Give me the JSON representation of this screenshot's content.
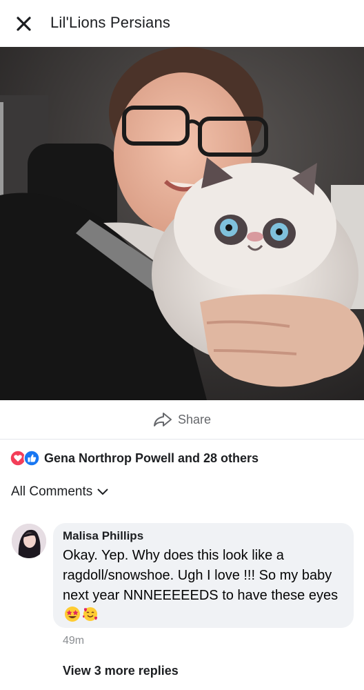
{
  "header": {
    "title": "Lil'Lions Persians",
    "close_icon": "close-icon"
  },
  "post": {
    "photo_description_icon": "post-photo",
    "share_label": "Share",
    "share_icon": "share-arrow-icon"
  },
  "reactions": {
    "icons": [
      "love-reaction-icon",
      "like-reaction-icon"
    ],
    "summary": "Gena Northrop Powell and 28 others",
    "colors": {
      "love": "#f33e58",
      "like": "#1877f2"
    }
  },
  "comments_filter": {
    "label": "All Comments",
    "icon": "chevron-down-icon"
  },
  "comments": [
    {
      "author": "Malisa Phillips",
      "text": "Okay. Yep. Why does this look like a ragdoll/snowshoe. Ugh I love !!! So my baby next year NNNEEEEEDS to have these eyes",
      "emojis": [
        "star-struck-emoji",
        "smiling-face-with-hearts-emoji"
      ],
      "time": "49m",
      "more_replies": "View 3 more replies"
    }
  ]
}
